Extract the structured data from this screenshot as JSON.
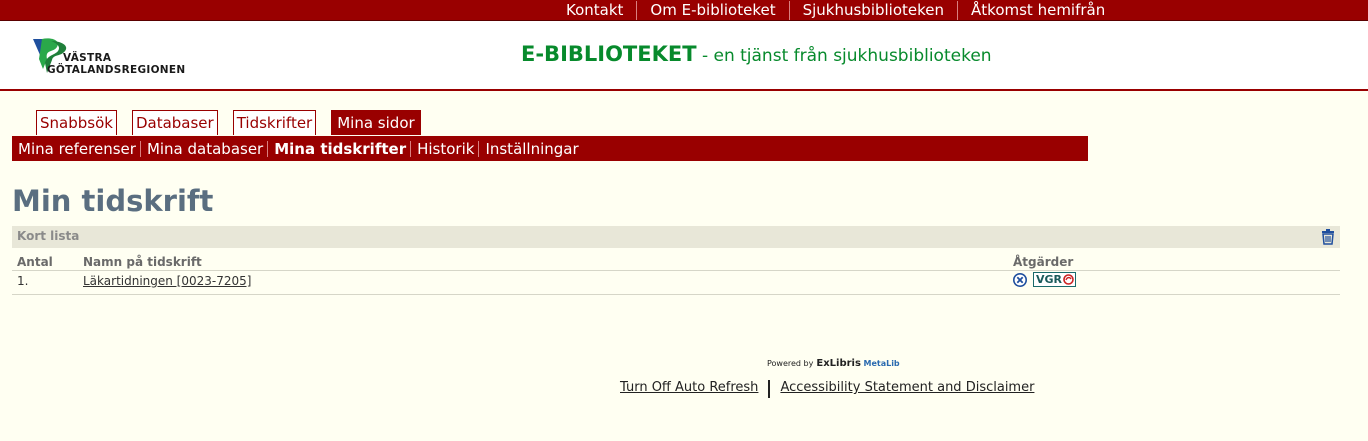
{
  "top_nav": {
    "links": [
      "Kontakt",
      "Om E-biblioteket",
      "Sjukhusbiblioteken",
      "Åtkomst hemifrån"
    ]
  },
  "header": {
    "logo_line1": "VÄSTRA",
    "logo_line2": "GÖTALANDSREGIONEN",
    "brand_main": "E-BIBLIOTEKET",
    "brand_sub": " - en tjänst från sjukhusbiblioteken"
  },
  "tabs": [
    "Snabbsök",
    "Databaser",
    "Tidskrifter",
    "Mina sidor"
  ],
  "subnav": [
    "Mina referenser",
    "Mina databaser",
    "Mina tidskrifter",
    "Historik",
    "Inställningar"
  ],
  "page_title": "Min tidskrift",
  "section_label": "Kort lista",
  "table": {
    "headers": [
      "Antal",
      "Namn på tidskrift",
      "Åtgärder"
    ],
    "rows": [
      {
        "num": "1.",
        "name": "Läkartidningen [0023-7205]"
      }
    ]
  },
  "vgr_label": "VGR",
  "footer": {
    "powered": "Powered by",
    "exlibris": "ExLibris",
    "metalib": "MetaLib",
    "links": [
      "Turn Off Auto Refresh",
      "Accessibility Statement and Disclaimer"
    ]
  },
  "colors": {
    "brand_red": "#990000",
    "brand_green": "#078a2c",
    "title_slate": "#5a6e80",
    "page_bg": "#fffff2"
  }
}
